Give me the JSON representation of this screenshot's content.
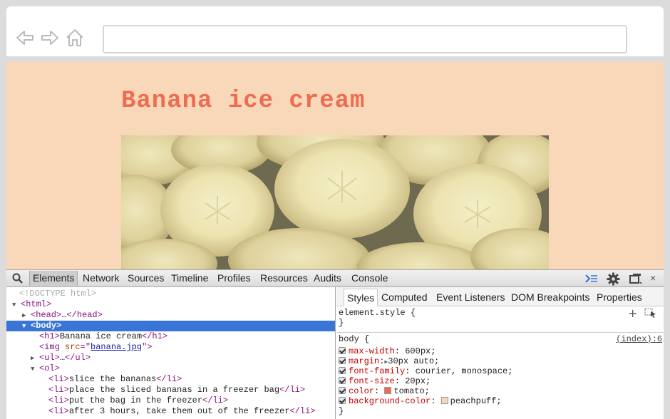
{
  "browser": {
    "url": "",
    "icons": [
      "back-arrow-icon",
      "forward-arrow-icon",
      "home-icon"
    ]
  },
  "page": {
    "title": "Banana ice cream",
    "title_color": "#ed6c52",
    "background": "#f9d7b9"
  },
  "devtools": {
    "tabs": [
      "Elements",
      "Network",
      "Sources",
      "Timeline",
      "Profiles",
      "Resources",
      "Audits",
      "Console"
    ],
    "active_tab": "Elements",
    "dom": {
      "doctype": "<!DOCTYPE html>",
      "html_open": "<html>",
      "head_open": "<head>",
      "ellipsis": "…",
      "head_close": "</head>",
      "body_open": "<body>",
      "h1_open": "<h1>",
      "h1_text": "Banana ice cream",
      "h1_close": "</h1>",
      "img_open": "<img",
      "img_attr": "src",
      "img_eq": "=\"",
      "img_src": "banana.jpg",
      "img_close": "\">",
      "ul_open": "<ul>",
      "ul_close": "</ul>",
      "ol_open": "<ol>",
      "li_open": "<li>",
      "li_close": "</li>",
      "li_items": [
        "slice the bananas",
        "place the sliced bananas in a freezer bag",
        "put the bag in the freezer",
        "after 3 hours, take them out of the freezer"
      ]
    },
    "styles_tabs": [
      "Styles",
      "Computed",
      "Event Listeners",
      "DOM Breakpoints",
      "Properties"
    ],
    "active_styles_tab": "Styles",
    "element_style": {
      "selector": "element.style {",
      "close": "}"
    },
    "body_rule": {
      "selector": "body {",
      "source": "(index):6",
      "close": "}",
      "declarations": [
        {
          "prop": "max-width",
          "value": "600px;"
        },
        {
          "prop": "margin",
          "value": "30px auto;"
        },
        {
          "prop": "font-family",
          "value": "courier, monospace;"
        },
        {
          "prop": "font-size",
          "value": "20px;"
        },
        {
          "prop": "color",
          "value": "tomato;",
          "swatch": "#ed6c52"
        },
        {
          "prop": "background-color",
          "value": "peachpuff;",
          "swatch": "#f9d7b9"
        }
      ]
    }
  }
}
